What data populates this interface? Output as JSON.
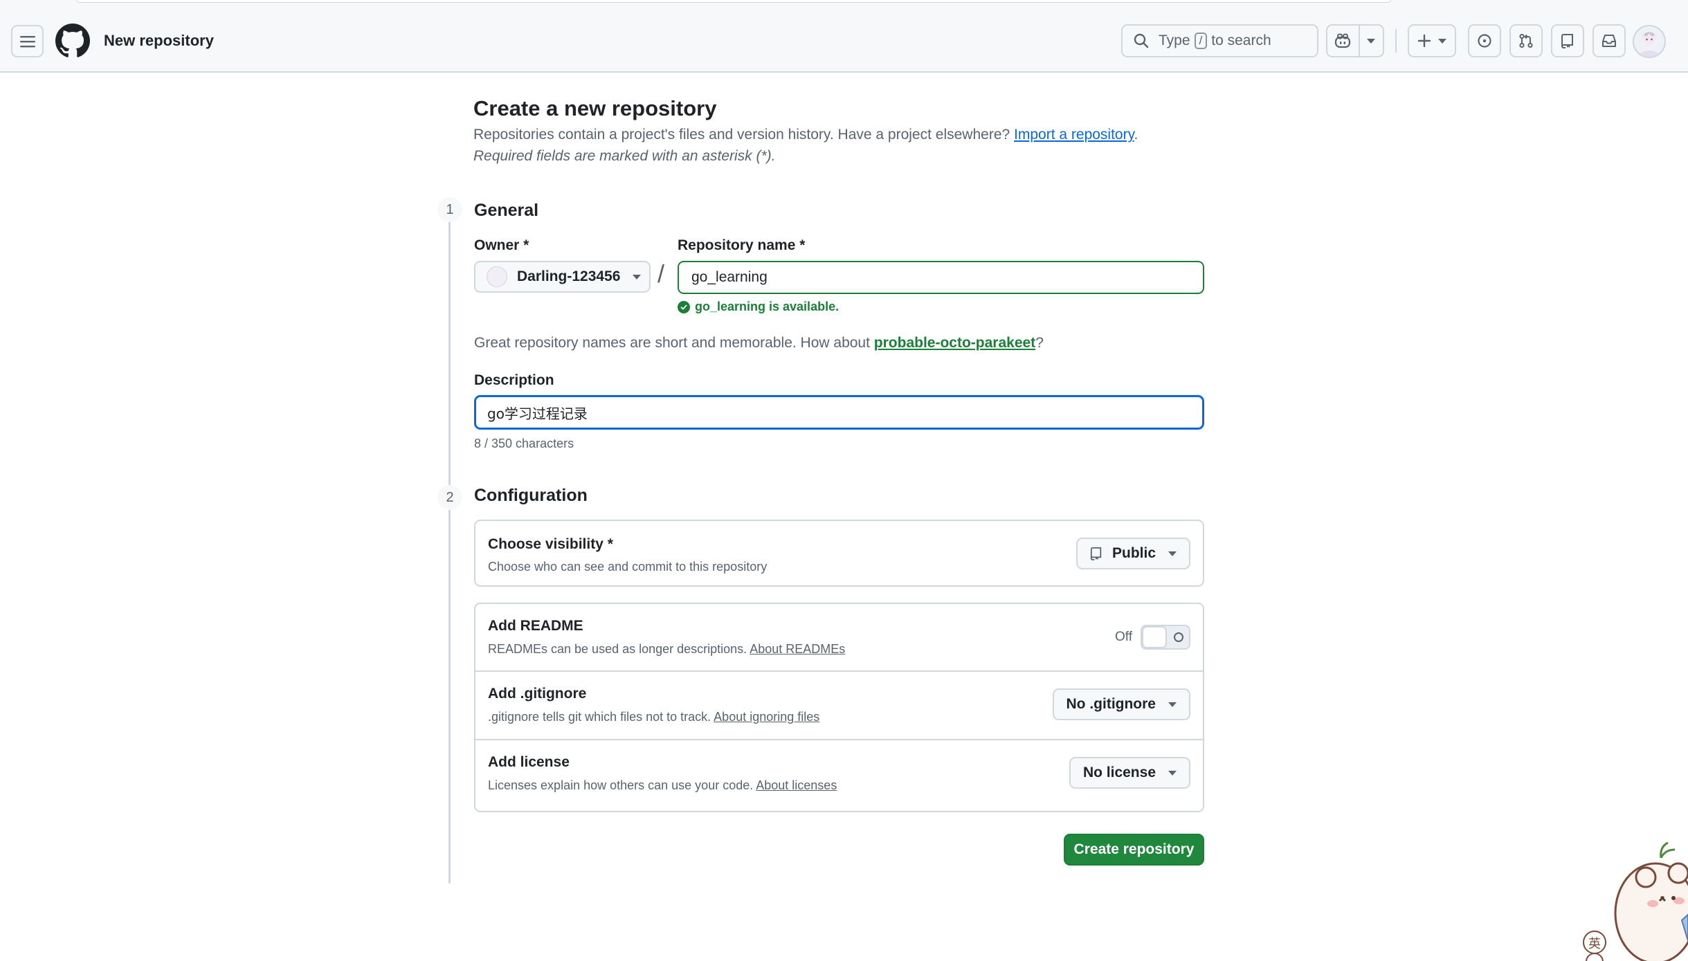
{
  "header": {
    "context_title": "New repository",
    "search_prefix": "Type",
    "search_key": "/",
    "search_suffix": "to search"
  },
  "page": {
    "title": "Create a new repository",
    "subtitle": "Repositories contain a project's files and version history. Have a project elsewhere?",
    "import_link": "Import a repository",
    "subtitle_end": ".",
    "required_note": "Required fields are marked with an asterisk (*)."
  },
  "general": {
    "step": "1",
    "title": "General",
    "owner_label": "Owner *",
    "owner_value": "Darling-123456",
    "slash": "/",
    "repo_label": "Repository name *",
    "repo_value": "go_learning",
    "availability": "go_learning is available.",
    "suggest_text": "Great repository names are short and memorable. How about",
    "suggest_name": "probable-octo-parakeet",
    "suggest_end": "?",
    "description_label": "Description",
    "description_value": "go学习过程记录",
    "char_count": "8 / 350 characters"
  },
  "configuration": {
    "step": "2",
    "title": "Configuration",
    "visibility": {
      "title": "Choose visibility *",
      "desc": "Choose who can see and commit to this repository",
      "value": "Public"
    },
    "readme": {
      "title": "Add README",
      "desc": "READMEs can be used as longer descriptions.",
      "link": "About READMEs",
      "toggle_label": "Off",
      "enabled": false
    },
    "gitignore": {
      "title": "Add .gitignore",
      "desc": ".gitignore tells git which files not to track.",
      "link": "About ignoring files",
      "value": "No .gitignore"
    },
    "license": {
      "title": "Add license",
      "desc": "Licenses explain how others can use your code.",
      "link": "About licenses",
      "value": "No license"
    }
  },
  "actions": {
    "create_label": "Create repository"
  },
  "colors": {
    "primary_green": "#1f883d",
    "link_blue": "#0969da",
    "success_green": "#1a7f37",
    "border": "#d0d7de",
    "muted_text": "#59636e"
  }
}
